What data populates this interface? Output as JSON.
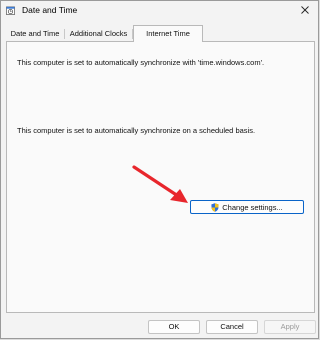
{
  "window": {
    "title": "Date and Time",
    "app_icon": "clock-calendar-icon",
    "close_icon": "close-icon"
  },
  "tabs": [
    {
      "label": "Date and Time",
      "active": false
    },
    {
      "label": "Additional Clocks",
      "active": false
    },
    {
      "label": "Internet Time",
      "active": true
    }
  ],
  "panel": {
    "sync_message": "This computer is set to automatically synchronize with 'time.windows.com'.",
    "schedule_message": "This computer is set to automatically synchronize on a scheduled basis.",
    "change_settings_label": "Change settings...",
    "change_settings_icon": "uac-shield-icon"
  },
  "footer": {
    "ok_label": "OK",
    "cancel_label": "Cancel",
    "apply_label": "Apply",
    "apply_enabled": false
  },
  "colors": {
    "accent": "#0a64c8",
    "arrow": "#e8262c"
  }
}
